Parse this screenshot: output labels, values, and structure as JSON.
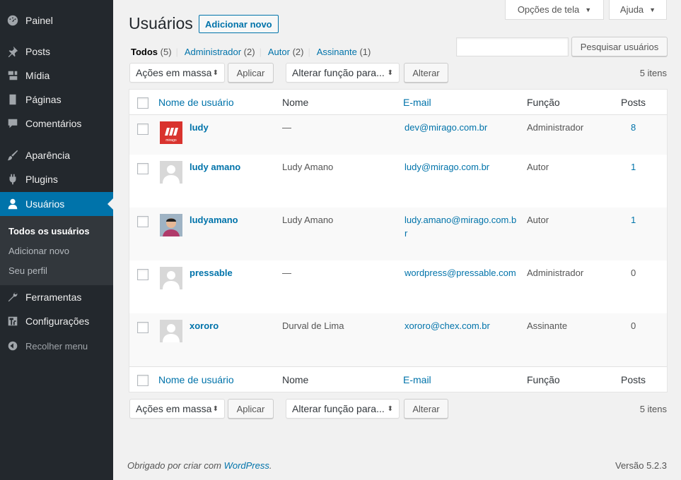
{
  "sidebar": {
    "items": [
      {
        "label": "Painel",
        "icon": "dashboard-icon"
      },
      {
        "label": "Posts",
        "icon": "pin-icon"
      },
      {
        "label": "Mídia",
        "icon": "media-icon"
      },
      {
        "label": "Páginas",
        "icon": "page-icon"
      },
      {
        "label": "Comentários",
        "icon": "comment-icon"
      },
      {
        "label": "Aparência",
        "icon": "brush-icon"
      },
      {
        "label": "Plugins",
        "icon": "plug-icon"
      },
      {
        "label": "Usuários",
        "icon": "user-icon"
      },
      {
        "label": "Ferramentas",
        "icon": "wrench-icon"
      },
      {
        "label": "Configurações",
        "icon": "settings-icon"
      }
    ],
    "submenu": [
      "Todos os usuários",
      "Adicionar novo",
      "Seu perfil"
    ],
    "collapse": "Recolher menu"
  },
  "header": {
    "screen_options": "Opções de tela",
    "help": "Ajuda",
    "title": "Usuários",
    "add_new": "Adicionar novo"
  },
  "views": [
    {
      "label": "Todos",
      "count": "(5)"
    },
    {
      "label": "Administrador",
      "count": "(2)"
    },
    {
      "label": "Autor",
      "count": "(2)"
    },
    {
      "label": "Assinante",
      "count": "(1)"
    }
  ],
  "search": {
    "button": "Pesquisar usuários",
    "value": ""
  },
  "bulk": {
    "actions": "Ações em massa",
    "apply": "Aplicar",
    "role": "Alterar função para...",
    "change": "Alterar",
    "count": "5 itens"
  },
  "columns": {
    "username": "Nome de usuário",
    "name": "Nome",
    "email": "E-mail",
    "role": "Função",
    "posts": "Posts"
  },
  "users": [
    {
      "username": "ludy",
      "name": "—",
      "email": "dev@mirago.com.br",
      "role": "Administrador",
      "posts": "8"
    },
    {
      "username": "ludy amano",
      "name": "Ludy Amano",
      "email": "ludy@mirago.com.br",
      "role": "Autor",
      "posts": "1"
    },
    {
      "username": "ludyamano",
      "name": "Ludy Amano",
      "email": "ludy.amano@mirago.com.br",
      "role": "Autor",
      "posts": "1"
    },
    {
      "username": "pressable",
      "name": "—",
      "email": "wordpress@pressable.com",
      "role": "Administrador",
      "posts": "0"
    },
    {
      "username": "xororo",
      "name": "Durval de Lima",
      "email": "xororo@chex.com.br",
      "role": "Assinante",
      "posts": "0"
    }
  ],
  "logo_text": "mirago",
  "footer": {
    "thanks": "Obrigado por criar com",
    "link": "WordPress",
    "dot": ".",
    "version": "Versão 5.2.3"
  },
  "colors": {
    "accent": "#0073aa",
    "sidebar": "#23282d",
    "submenu": "#32373c"
  }
}
